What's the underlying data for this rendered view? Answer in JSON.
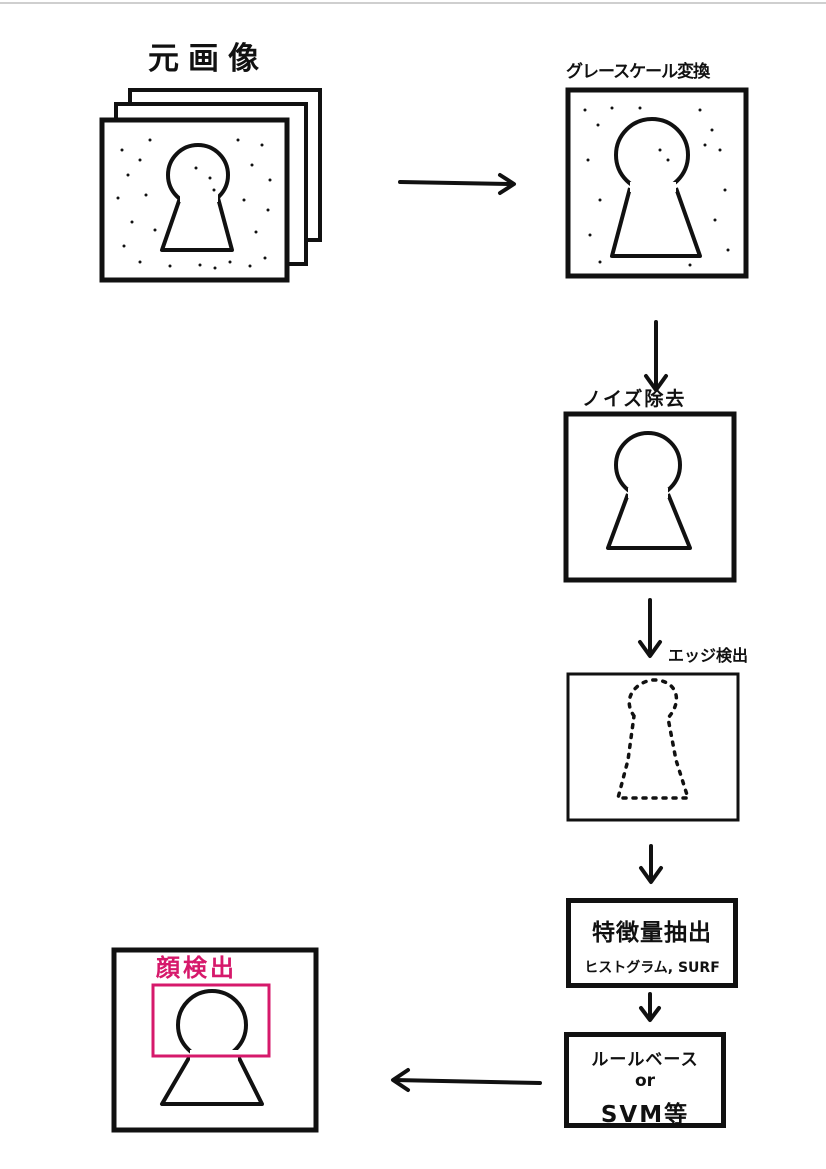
{
  "labels": {
    "original": "元画像",
    "grayscale": "グレースケール変換",
    "denoise": "ノイズ除去",
    "edge": "エッジ検出",
    "feature_title": "特徴量抽出",
    "feature_sub": "ヒストグラム, SURF",
    "classifier_line1": "ルールベース",
    "classifier_line2": "or",
    "classifier_line3": "SVM等",
    "face_detect": "顔検出"
  },
  "colors": {
    "ink": "#111111",
    "accent": "#d6196b",
    "background": "#ffffff"
  },
  "icons": [
    "keyhole-silhouette-icon",
    "arrow-right-icon",
    "arrow-down-icon",
    "arrow-left-icon"
  ]
}
